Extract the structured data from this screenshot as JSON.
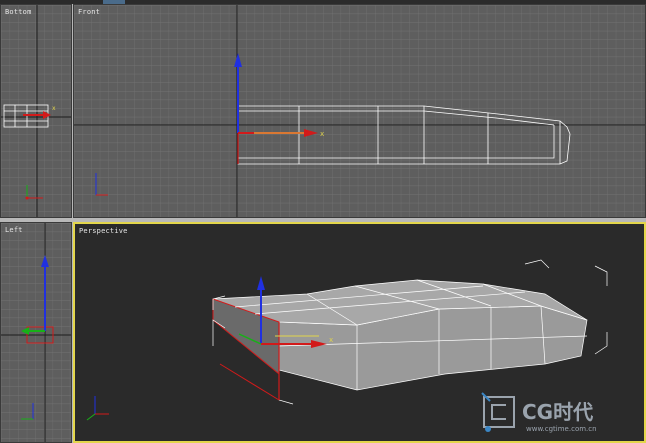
{
  "viewports": {
    "bottom": {
      "label": "Bottom"
    },
    "front": {
      "label": "Front"
    },
    "left": {
      "label": "Left"
    },
    "perspective": {
      "label": "Perspective"
    }
  },
  "watermark": {
    "brand": "CG时代",
    "url": "www.cgtime.com.cn"
  },
  "colors": {
    "active_border": "#e3d64b",
    "wire": "#ffffff",
    "gizmo_x": "#d21a1a",
    "gizmo_y": "#18b018",
    "gizmo_z": "#2030e0"
  }
}
